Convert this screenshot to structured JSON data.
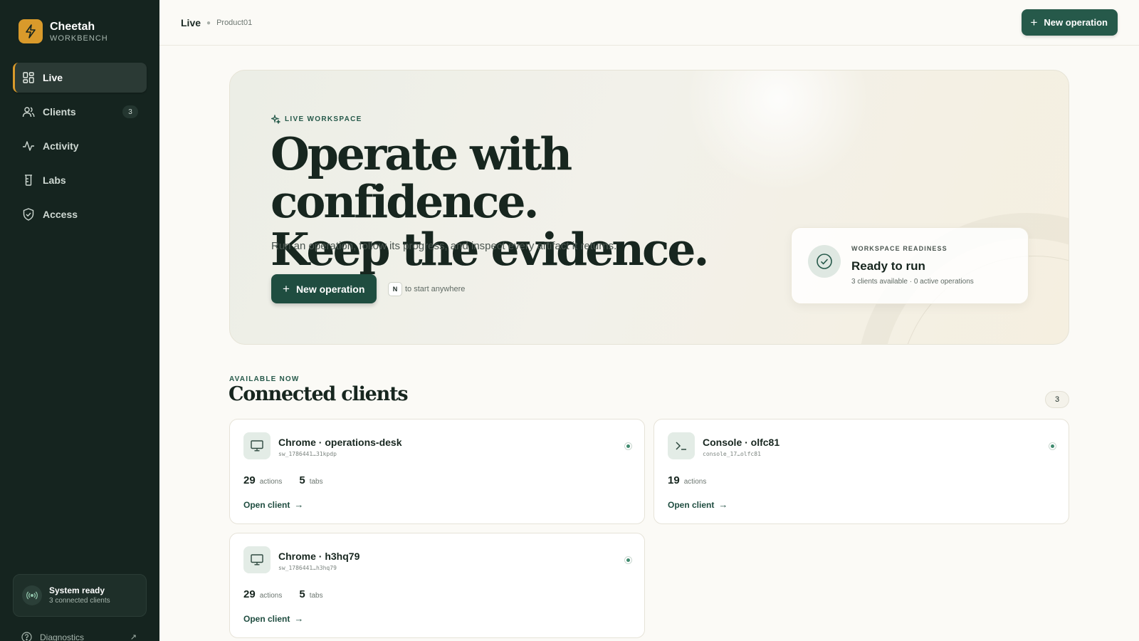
{
  "brand": {
    "name": "Cheetah",
    "subtitle": "WORKBENCH"
  },
  "sidebar": {
    "items": [
      {
        "label": "Live",
        "icon": "dashboard-icon",
        "active": true
      },
      {
        "label": "Clients",
        "icon": "users-icon",
        "badge": "3"
      },
      {
        "label": "Activity",
        "icon": "activity-icon"
      },
      {
        "label": "Labs",
        "icon": "flask-icon"
      },
      {
        "label": "Access",
        "icon": "shield-check-icon"
      }
    ],
    "system": {
      "title": "System ready",
      "subtitle": "3 connected clients"
    },
    "diagnostics": {
      "label": "Diagnostics"
    }
  },
  "topbar": {
    "breadcrumb": {
      "current": "Live",
      "product": "Product01"
    },
    "new_operation_label": "New operation"
  },
  "hero": {
    "eyebrow": "LIVE WORKSPACE",
    "headline_line1": "Operate with confidence.",
    "headline_line2": "Keep the evidence.",
    "subtitle": "Run an operation, follow its progress, and inspect every artifact it returns.",
    "button_label": "New operation",
    "shortcut_key": "N",
    "shortcut_hint": "to start anywhere",
    "readiness": {
      "eyebrow": "WORKSPACE READINESS",
      "title": "Ready to run",
      "subtitle": "3 clients available · 0 active operations"
    }
  },
  "clients_section": {
    "eyebrow": "AVAILABLE NOW",
    "title": "Connected clients",
    "count": "3",
    "clients": [
      {
        "name": "Chrome · operations-desk",
        "id": "sw_1786441…31kpdp",
        "icon": "monitor-icon",
        "stats": [
          {
            "value": "29",
            "unit": "actions"
          },
          {
            "value": "5",
            "unit": "tabs"
          }
        ],
        "link_label": "Open client"
      },
      {
        "name": "Console · olfc81",
        "id": "console_17…olfc81",
        "icon": "terminal-icon",
        "stats": [
          {
            "value": "19",
            "unit": "actions"
          }
        ],
        "link_label": "Open client"
      },
      {
        "name": "Chrome · h3hq79",
        "id": "sw_1786441…h3hq79",
        "icon": "monitor-icon",
        "stats": [
          {
            "value": "29",
            "unit": "actions"
          },
          {
            "value": "5",
            "unit": "tabs"
          }
        ],
        "link_label": "Open client"
      }
    ]
  },
  "colors": {
    "sidebar_bg": "#15241f",
    "accent_green": "#26594a",
    "brand_amber": "#d99a2b",
    "page_bg": "#fbfaf6"
  }
}
